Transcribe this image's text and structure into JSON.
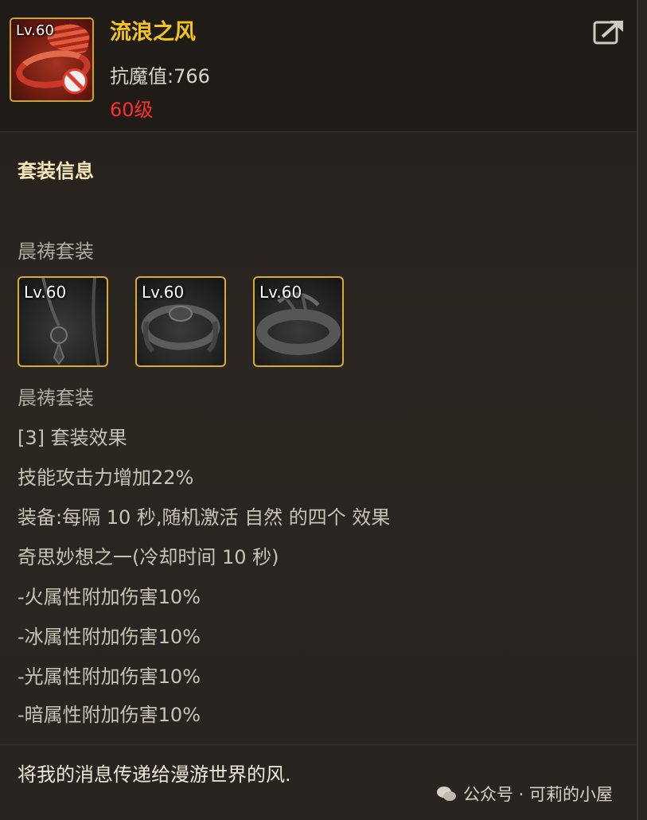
{
  "item": {
    "level_badge": "Lv.60",
    "name": "流浪之风",
    "stat": "抗魔值:766",
    "required_level": "60级",
    "icon": "wing-band-icon"
  },
  "share_icon": "share-icon",
  "set_info": {
    "heading": "套装信息",
    "set_name": "晨祷套装",
    "pieces": [
      {
        "level_badge": "Lv.60",
        "icon": "necklace-icon"
      },
      {
        "level_badge": "Lv.60",
        "icon": "bracelet-icon"
      },
      {
        "level_badge": "Lv.60",
        "icon": "ring-icon"
      }
    ],
    "set_name_repeat": "晨祷套装",
    "effect_lines": [
      "[3] 套装效果",
      "技能攻击力增加22%",
      "装备:每隔 10 秒,随机激活 自然 的四个 效果",
      "奇思妙想之一(冷却时间 10 秒)",
      "-火属性附加伤害10%",
      "-冰属性附加伤害10%",
      "-光属性附加伤害10%",
      "-暗属性附加伤害10%"
    ]
  },
  "flavor_text": "将我的消息传递给漫游世界的风.",
  "watermark": "公众号 · 可莉的小屋",
  "colors": {
    "title": "#f5c518",
    "level_required": "#ff2f2f",
    "frame_gold": "#d9ab33"
  }
}
